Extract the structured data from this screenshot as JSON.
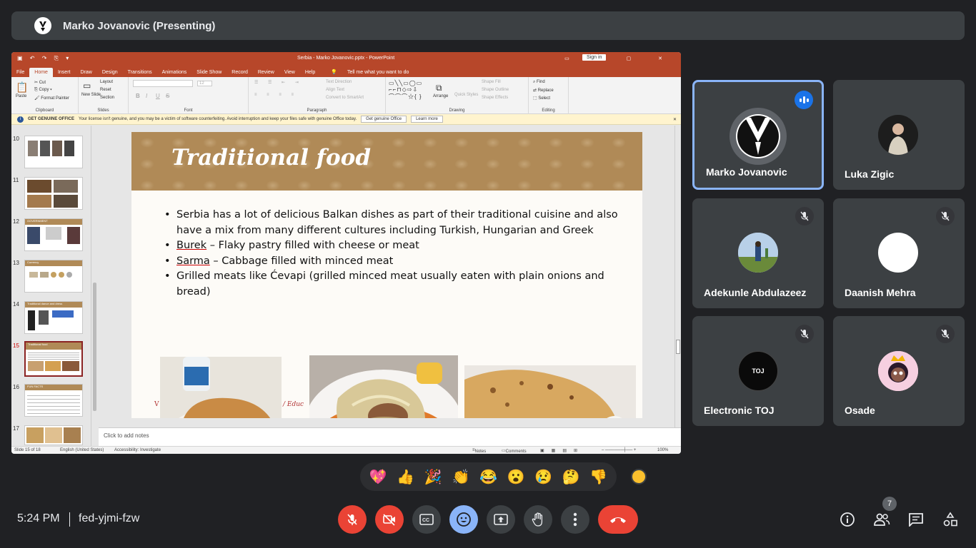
{
  "presenter_bar": {
    "name": "Marko Jovanovic (Presenting)"
  },
  "powerpoint": {
    "window_title": "Serbia - Marko Jovanovic.pptx - PowerPoint",
    "sign_in": "Sign in",
    "menu": [
      "File",
      "Home",
      "Insert",
      "Draw",
      "Design",
      "Transitions",
      "Animations",
      "Slide Show",
      "Record",
      "Review",
      "View",
      "Help"
    ],
    "tell_me": "Tell me what you want to do",
    "ribbon": {
      "clipboard": {
        "label": "Clipboard",
        "paste": "Paste",
        "cut": "Cut",
        "copy": "Copy",
        "format_painter": "Format Painter"
      },
      "slides": {
        "label": "Slides",
        "new_slide": "New Slide",
        "layout": "Layout",
        "reset": "Reset",
        "section": "Section"
      },
      "font": {
        "label": "Font",
        "bold": "B",
        "italic": "I",
        "underline": "U",
        "strike": "S",
        "font_size": "12"
      },
      "paragraph": {
        "label": "Paragraph",
        "text_direction": "Text Direction",
        "align_text": "Align Text",
        "convert_smartart": "Convert to SmartArt"
      },
      "drawing": {
        "label": "Drawing",
        "arrange": "Arrange",
        "quick_styles": "Quick Styles",
        "shape_fill": "Shape Fill",
        "shape_outline": "Shape Outline",
        "shape_effects": "Shape Effects"
      },
      "editing": {
        "label": "Editing",
        "find": "Find",
        "replace": "Replace",
        "select": "Select"
      }
    },
    "infobar": {
      "title": "GET GENUINE OFFICE",
      "message": "Your license isn't genuine, and you may be a victim of software counterfeiting. Avoid interruption and keep your files safe with genuine Office today.",
      "btn_get": "Get genuine Office",
      "btn_learn": "Learn more"
    },
    "thumbnails": [
      {
        "num": "10",
        "title": ""
      },
      {
        "num": "11",
        "title": ""
      },
      {
        "num": "12",
        "title": "GOVERNMENT"
      },
      {
        "num": "13",
        "title": "Currency"
      },
      {
        "num": "14",
        "title": "Traditional dance and dress"
      },
      {
        "num": "15",
        "title": "Traditional food"
      },
      {
        "num": "16",
        "title": "FUN FACTS"
      },
      {
        "num": "17",
        "title": ""
      }
    ],
    "slide": {
      "title": "Traditional food",
      "bullets": [
        {
          "lead": "",
          "rest": "Serbia has a lot of delicious Balkan dishes as part of their traditional cuisine and also have a mix from many different cultures including Turkish, Hungarian and Greek"
        },
        {
          "lead": "Burek",
          "rest": " – Flaky pastry filled with cheese or meat"
        },
        {
          "lead": "Sarma",
          "rest": " – Cabbage filled with minced meat"
        },
        {
          "lead": "",
          "rest": "Grilled meats like Ćevapi (grilled minced meat usually eaten with plain onions and bread)"
        }
      ],
      "footer_left": "V",
      "footer_mid": "/ Educ"
    },
    "notes_placeholder": "Click to add notes",
    "status": {
      "slide": "Slide 15 of 18",
      "language": "English (United States)",
      "accessibility": "Accessibility: Investigate",
      "notes": "Notes",
      "comments": "Comments",
      "zoom": "100%"
    }
  },
  "participants": [
    {
      "name": "Marko Jovanovic",
      "speaking": true,
      "muted": false
    },
    {
      "name": "Luka Zigic",
      "speaking": false,
      "muted": false
    },
    {
      "name": "Adekunle Abdulazeez",
      "speaking": false,
      "muted": true
    },
    {
      "name": "Daanish Mehra",
      "speaking": false,
      "muted": true
    },
    {
      "name": "Electronic TOJ",
      "speaking": false,
      "muted": true,
      "avatar_text": "TOJ"
    },
    {
      "name": "Osade",
      "speaking": false,
      "muted": true
    }
  ],
  "reactions": [
    "💖",
    "👍",
    "🎉",
    "👏",
    "😂",
    "😮",
    "😢",
    "🤔",
    "👎"
  ],
  "bottom": {
    "time": "5:24 PM",
    "meeting_code": "fed-yjmi-fzw",
    "people_count": "7"
  },
  "colors": {
    "ppt_accent": "#b7472a",
    "meet_bg": "#202124",
    "tile_bg": "#3c4043",
    "danger": "#ea4335",
    "speaking": "#1a73e8"
  }
}
